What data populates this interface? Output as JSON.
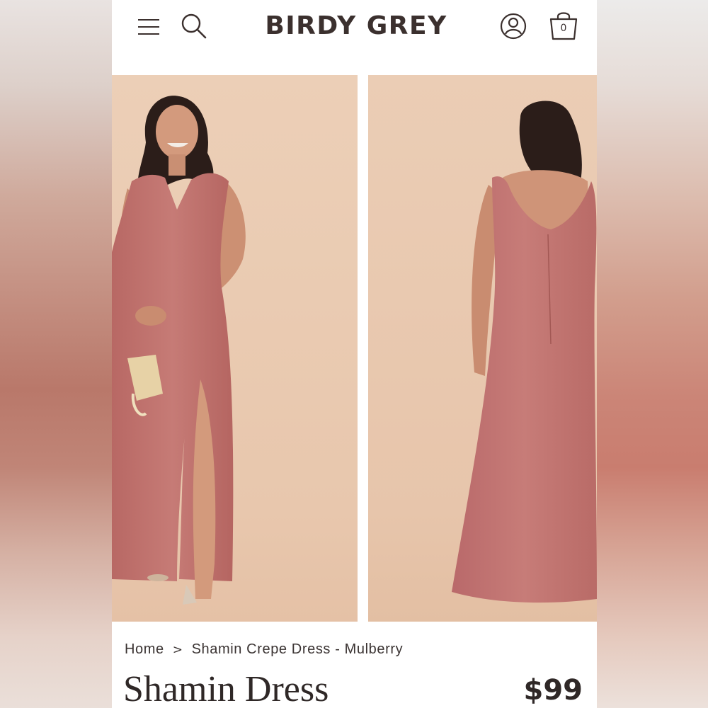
{
  "header": {
    "brand": "BIRDY GREY",
    "cart_count": "0",
    "icons": [
      "menu-icon",
      "search-icon",
      "account-icon",
      "shopping-bag-icon"
    ]
  },
  "gallery": {
    "images": [
      {
        "name": "front-view",
        "alt": "Shamin Crepe Dress - Mulberry front view"
      },
      {
        "name": "back-view",
        "alt": "Shamin Crepe Dress - Mulberry back view"
      }
    ]
  },
  "breadcrumb": {
    "items": [
      "Home",
      "Shamin Crepe Dress - Mulberry"
    ],
    "separator": ">"
  },
  "product": {
    "title": "Shamin Dress",
    "price": "$99"
  },
  "colors": {
    "dress": "#c37471",
    "backdrop": "#ebcdb5",
    "text": "#3b302e"
  }
}
